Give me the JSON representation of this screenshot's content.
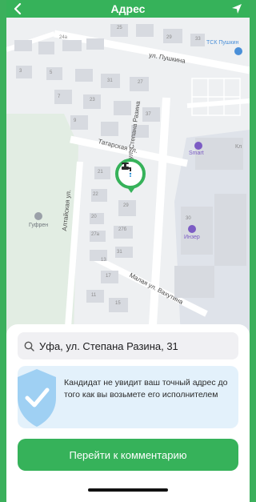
{
  "header": {
    "title": "Адрес",
    "back_icon": "chevron-left-icon",
    "location_icon": "navigation-arrow-icon",
    "color": "#36b25a"
  },
  "map": {
    "streets": {
      "pushkina": "ул. Пушкина",
      "tatarskaya": "Татарская ул.",
      "razina": "ул. Степана Разина",
      "altaiskaya": "Алтайская ул.",
      "malaya": "Малая ул. Вахутина"
    },
    "pois": {
      "tsk": "ТСК Пушкин",
      "smart": "Smart",
      "inzer": "Инзер",
      "gufren": "Гуфрен",
      "kl": "Кл"
    },
    "house_numbers": [
      "24а",
      "25",
      "29",
      "33",
      "31",
      "23",
      "27",
      "21",
      "22",
      "29",
      "20",
      "27б",
      "27а",
      "31",
      "17",
      "11",
      "15",
      "13",
      "37",
      "30",
      "3",
      "5",
      "7",
      "9"
    ]
  },
  "search": {
    "value": "Уфа, ул. Степана Разина, 31",
    "icon": "search-icon"
  },
  "notice": {
    "text": "Кандидат не увидит ваш точный адрес до того как вы возьмете его исполнителем",
    "icon": "shield-check-icon"
  },
  "action": {
    "label": "Перейти к комментарию"
  }
}
